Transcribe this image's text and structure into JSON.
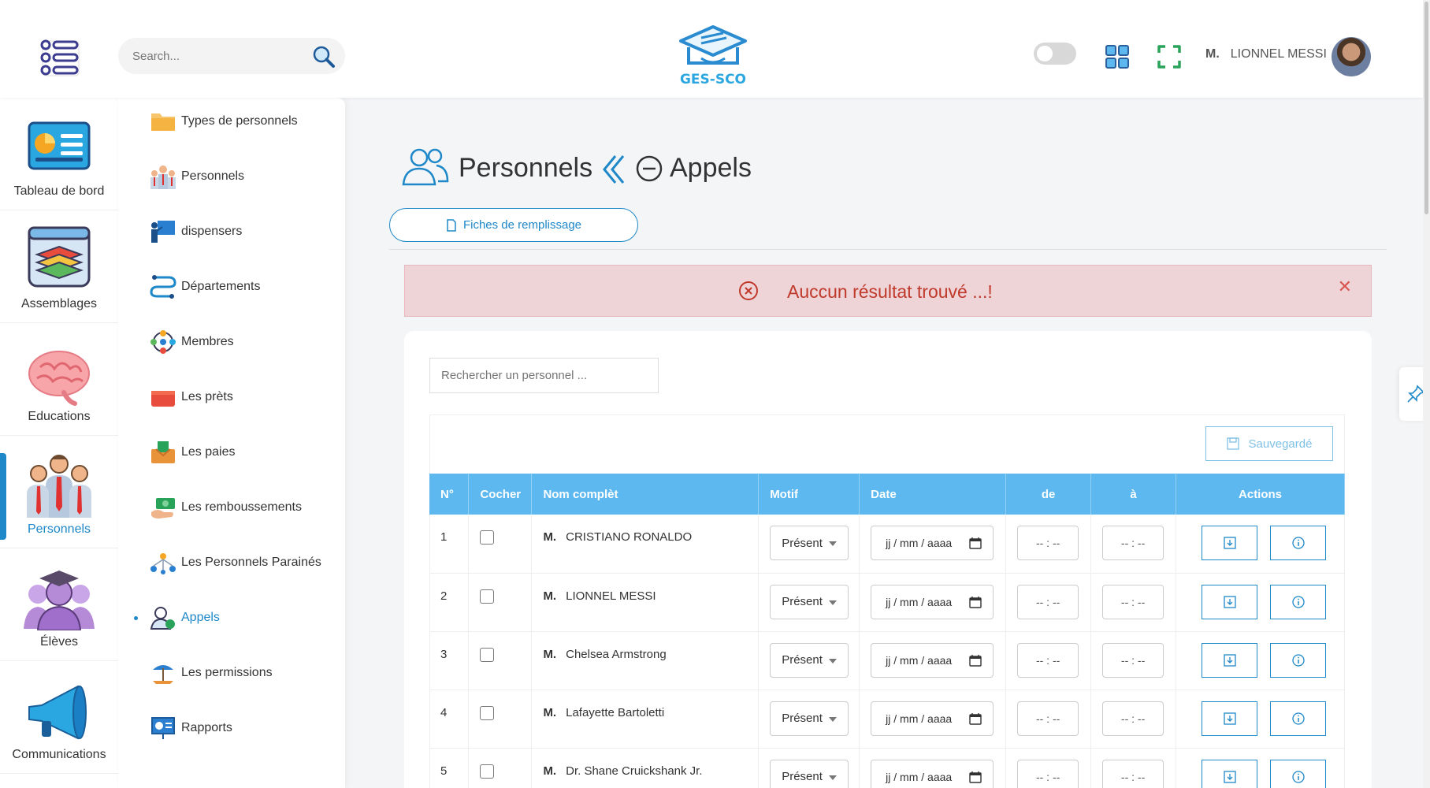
{
  "header": {
    "search_placeholder": "Search...",
    "logo_text": "GES-SCO",
    "user_title": "M.",
    "user_name": "LIONNEL MESSI"
  },
  "sidebar": {
    "items": [
      {
        "label": "Tableau de bord",
        "icon": "dashboard-icon"
      },
      {
        "label": "Assemblages",
        "icon": "layers-icon"
      },
      {
        "label": "Educations",
        "icon": "brain-icon"
      },
      {
        "label": "Personnels",
        "icon": "staff-icon",
        "active": true
      },
      {
        "label": "Élèves",
        "icon": "student-icon"
      },
      {
        "label": "Communications",
        "icon": "megaphone-icon"
      }
    ]
  },
  "submenu": {
    "items": [
      {
        "label": "Types de personnels",
        "icon": "folder-icon"
      },
      {
        "label": "Personnels",
        "icon": "people-icon"
      },
      {
        "label": "dispensers",
        "icon": "teacher-board-icon"
      },
      {
        "label": "Départements",
        "icon": "flow-icon"
      },
      {
        "label": "Membres",
        "icon": "members-icon"
      },
      {
        "label": "Les prèts",
        "icon": "wallet-icon"
      },
      {
        "label": "Les paies",
        "icon": "pay-icon"
      },
      {
        "label": "Les remboussements",
        "icon": "refund-icon"
      },
      {
        "label": "Les Personnels Parainés",
        "icon": "sponsor-icon"
      },
      {
        "label": "Appels",
        "icon": "call-person-icon",
        "active": true
      },
      {
        "label": "Les permissions",
        "icon": "beach-icon"
      },
      {
        "label": "Rapports",
        "icon": "report-icon"
      }
    ]
  },
  "page": {
    "title": "Personnels",
    "subtitle": "Appels",
    "fiches_label": "Fiches de remplissage"
  },
  "alert": {
    "message": "Auccun résultat trouvé ...!"
  },
  "card": {
    "search_placeholder": "Rechercher un personnel ...",
    "save_label": "Sauvegardé"
  },
  "table": {
    "headers": [
      "N°",
      "Cocher",
      "Nom complèt",
      "Motif",
      "Date",
      "de",
      "à",
      "Actions"
    ],
    "date_placeholder": "jj / mm / aaaa",
    "time_placeholder": "-- : --",
    "rows": [
      {
        "n": "1",
        "civ": "M.",
        "name": "CRISTIANO RONALDO",
        "motif": "Présent"
      },
      {
        "n": "2",
        "civ": "M.",
        "name": "LIONNEL MESSI",
        "motif": "Présent"
      },
      {
        "n": "3",
        "civ": "M.",
        "name": "Chelsea Armstrong",
        "motif": "Présent"
      },
      {
        "n": "4",
        "civ": "M.",
        "name": "Lafayette Bartoletti",
        "motif": "Présent"
      },
      {
        "n": "5",
        "civ": "M.",
        "name": "Dr. Shane Cruickshank Jr.",
        "motif": "Présent"
      }
    ]
  },
  "colors": {
    "accent": "#1e88c8",
    "table_header": "#5db8f0",
    "alert_bg": "#eed3d7",
    "alert_text": "#c0392b"
  }
}
